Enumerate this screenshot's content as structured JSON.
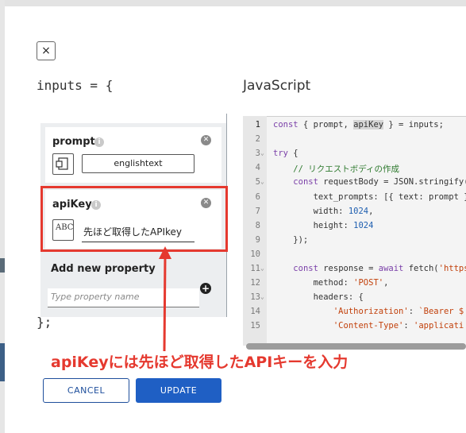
{
  "modal": {
    "close_glyph": "×",
    "inputs_open": "inputs = {",
    "inputs_close": "};",
    "js_title": "JavaScript"
  },
  "properties": [
    {
      "name": "prompt",
      "value": "englishtext",
      "type_icon": "text-doc-icon"
    },
    {
      "name": "apiKey",
      "value": "先ほど取得したAPIkey",
      "type_icon": "abc-icon",
      "type_glyph": "ABC"
    }
  ],
  "add_property": {
    "title": "Add new property",
    "placeholder": "Type property name",
    "plus_glyph": "+"
  },
  "code": {
    "lines": [
      {
        "n": "1",
        "fold": "",
        "html": "<span class=\"tok-kw\">const</span> { prompt, <span class=\"tok-sel\">apiKey</span> } = inputs;"
      },
      {
        "n": "2",
        "fold": "",
        "html": ""
      },
      {
        "n": "3",
        "fold": "⌄",
        "html": "<span class=\"tok-kw\">try</span> {"
      },
      {
        "n": "4",
        "fold": "",
        "html": "    <span class=\"tok-cm\">// リクエストボディの作成</span>"
      },
      {
        "n": "5",
        "fold": "⌄",
        "html": "    <span class=\"tok-kw\">const</span> requestBody = JSON.stringify({"
      },
      {
        "n": "6",
        "fold": "",
        "html": "        text_prompts: [{ text: prompt }],"
      },
      {
        "n": "7",
        "fold": "",
        "html": "        width: <span class=\"tok-num\">1024</span>,"
      },
      {
        "n": "8",
        "fold": "",
        "html": "        height: <span class=\"tok-num\">1024</span>"
      },
      {
        "n": "9",
        "fold": "",
        "html": "    });"
      },
      {
        "n": "10",
        "fold": "",
        "html": ""
      },
      {
        "n": "11",
        "fold": "⌄",
        "html": "    <span class=\"tok-kw\">const</span> response = <span class=\"tok-kw\">await</span> fetch(<span class=\"tok-str\">'https:</span>"
      },
      {
        "n": "12",
        "fold": "",
        "html": "        method: <span class=\"tok-str\">'POST'</span>,"
      },
      {
        "n": "13",
        "fold": "⌄",
        "html": "        headers: {"
      },
      {
        "n": "14",
        "fold": "",
        "html": "            <span class=\"tok-str\">'Authorization'</span>: <span class=\"tok-str\">`Bearer $</span>"
      },
      {
        "n": "15",
        "fold": "",
        "html": "            <span class=\"tok-str\">'Content-Type'</span>: <span class=\"tok-str\">'applicati</span>"
      }
    ]
  },
  "annotation": {
    "text": "apiKeyには先ほど取得したAPIキーを入力",
    "color": "#e5392f"
  },
  "buttons": {
    "cancel": "CANCEL",
    "update": "UPDATE"
  },
  "colors": {
    "accent": "#1f5fc4",
    "highlight": "#e5392f"
  }
}
